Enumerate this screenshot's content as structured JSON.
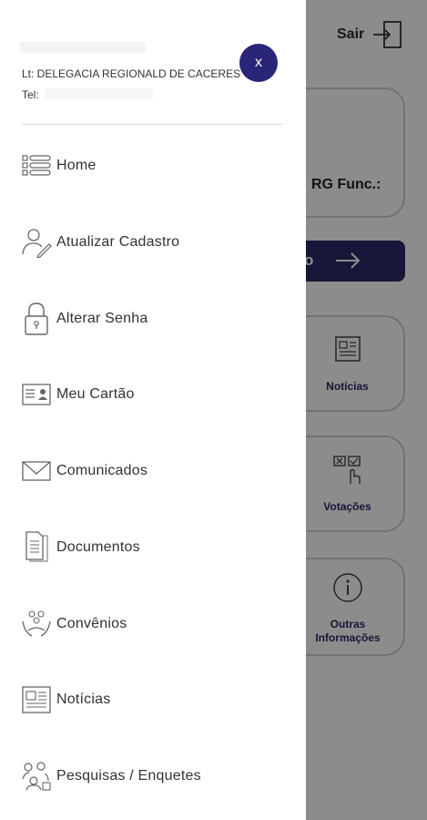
{
  "background": {
    "sair_label": "Sair",
    "rg_label": "RG Func.:",
    "button_text": "o",
    "tiles": [
      {
        "label": "Notícias"
      },
      {
        "label": "Votações"
      },
      {
        "label": "Outras Informações"
      }
    ]
  },
  "drawer": {
    "header": {
      "lotacao": "Lt: DELEGACIA REGIONALD DE CACERES",
      "tel_label": "Tel:",
      "close_label": "x"
    },
    "items": [
      {
        "label": "Home",
        "icon": "list-icon"
      },
      {
        "label": "Atualizar Cadastro",
        "icon": "user-edit-icon"
      },
      {
        "label": "Alterar Senha",
        "icon": "lock-icon"
      },
      {
        "label": "Meu Cartão",
        "icon": "id-card-icon"
      },
      {
        "label": "Comunicados",
        "icon": "envelope-icon"
      },
      {
        "label": "Documentos",
        "icon": "documents-icon"
      },
      {
        "label": "Convênios",
        "icon": "partnership-icon"
      },
      {
        "label": "Notícias",
        "icon": "newspaper-icon"
      },
      {
        "label": "Pesquisas / Enquetes",
        "icon": "survey-icon"
      }
    ]
  },
  "colors": {
    "accent": "#2a2579",
    "button_bg": "#2a2966",
    "overlay": "#000000"
  }
}
